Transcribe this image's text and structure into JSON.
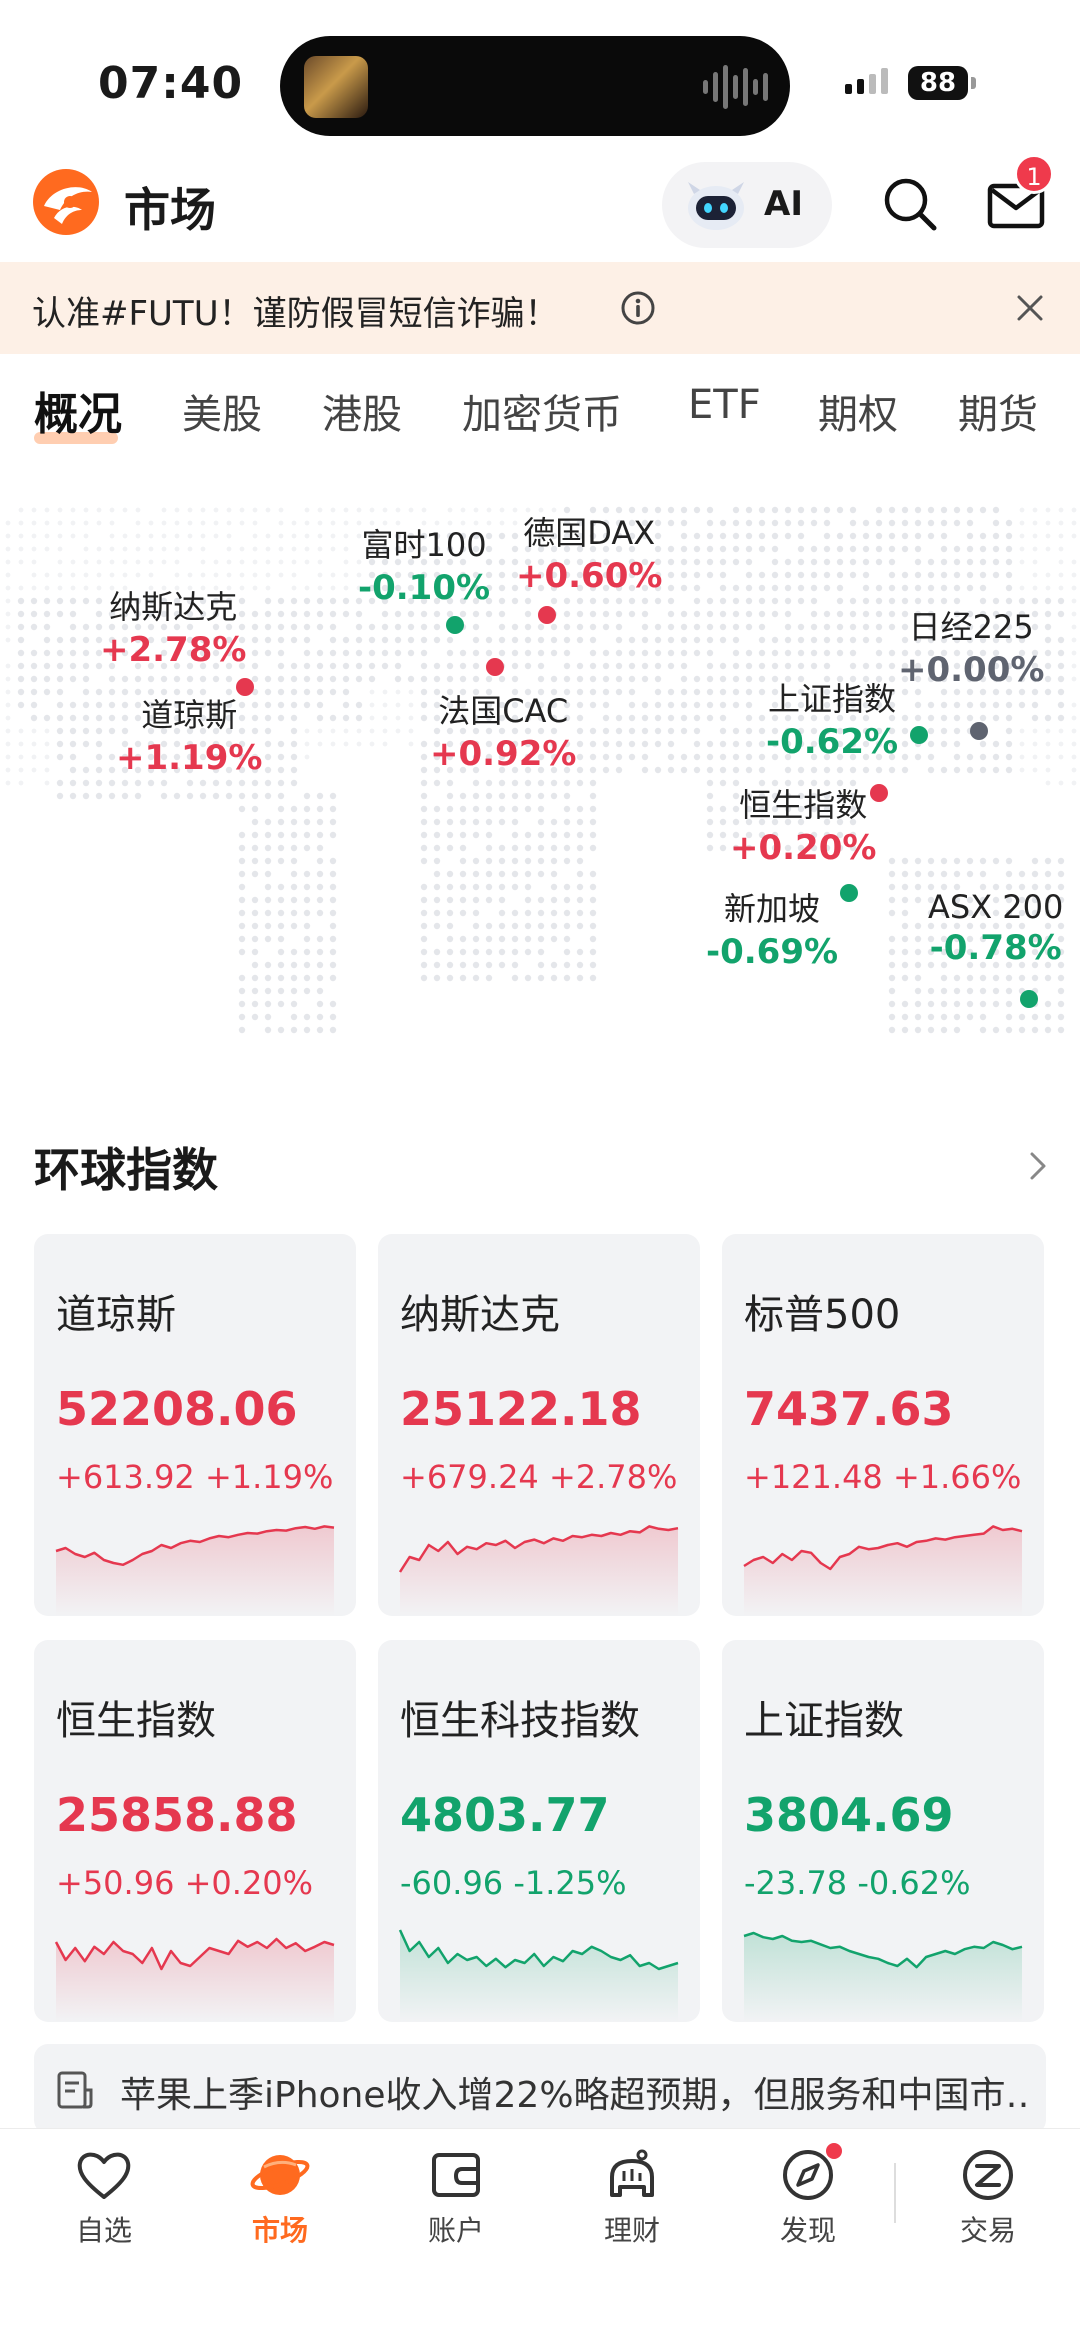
{
  "status": {
    "time": "07:40",
    "battery": "88"
  },
  "header": {
    "title": "市场",
    "ai_label": "AI",
    "mail_badge": "1"
  },
  "notice": {
    "text": "认准#FUTU！谨防假冒短信诈骗！"
  },
  "tabs": [
    {
      "label": "概况",
      "active": true
    },
    {
      "label": "美股"
    },
    {
      "label": "港股"
    },
    {
      "label": "加密货币"
    },
    {
      "label": "ETF"
    },
    {
      "label": "期权"
    },
    {
      "label": "期货"
    }
  ],
  "map_indices": [
    {
      "name": "纳斯达克",
      "change": "+2.78%",
      "trend": "up"
    },
    {
      "name": "道琼斯",
      "change": "+1.19%",
      "trend": "up"
    },
    {
      "name": "富时100",
      "change": "-0.10%",
      "trend": "down"
    },
    {
      "name": "德国DAX",
      "change": "+0.60%",
      "trend": "up"
    },
    {
      "name": "法国CAC",
      "change": "+0.92%",
      "trend": "up"
    },
    {
      "name": "日经225",
      "change": "+0.00%",
      "trend": "flat"
    },
    {
      "name": "上证指数",
      "change": "-0.62%",
      "trend": "down"
    },
    {
      "name": "恒生指数",
      "change": "+0.20%",
      "trend": "up"
    },
    {
      "name": "新加坡",
      "change": "-0.69%",
      "trend": "down"
    },
    {
      "name": "ASX 200",
      "change": "-0.78%",
      "trend": "down"
    }
  ],
  "global_indices": {
    "title": "环球指数",
    "cards": [
      {
        "name": "道琼斯",
        "value": "52208.06",
        "change": "+613.92 +1.19%",
        "trend": "up",
        "spark": [
          0.45,
          0.5,
          0.4,
          0.35,
          0.42,
          0.3,
          0.25,
          0.22,
          0.3,
          0.4,
          0.45,
          0.55,
          0.5,
          0.58,
          0.62,
          0.6,
          0.66,
          0.7,
          0.68,
          0.72,
          0.75,
          0.74,
          0.78,
          0.8,
          0.79,
          0.83,
          0.85,
          0.82,
          0.86,
          0.84
        ]
      },
      {
        "name": "纳斯达克",
        "value": "25122.18",
        "change": "+679.24 +2.78%",
        "trend": "up",
        "spark": [
          0.1,
          0.35,
          0.3,
          0.55,
          0.45,
          0.6,
          0.4,
          0.52,
          0.48,
          0.58,
          0.55,
          0.62,
          0.5,
          0.6,
          0.64,
          0.58,
          0.66,
          0.62,
          0.7,
          0.68,
          0.72,
          0.7,
          0.75,
          0.72,
          0.78,
          0.76,
          0.86,
          0.82,
          0.8,
          0.83
        ]
      },
      {
        "name": "标普500",
        "value": "7437.63",
        "change": "+121.48 +1.66%",
        "trend": "up",
        "spark": [
          0.2,
          0.3,
          0.35,
          0.25,
          0.4,
          0.3,
          0.45,
          0.42,
          0.25,
          0.15,
          0.35,
          0.4,
          0.52,
          0.48,
          0.5,
          0.55,
          0.58,
          0.52,
          0.6,
          0.62,
          0.66,
          0.64,
          0.68,
          0.7,
          0.72,
          0.74,
          0.86,
          0.8,
          0.82,
          0.78
        ]
      },
      {
        "name": "恒生指数",
        "value": "25858.88",
        "change": "+50.96 +0.20%",
        "trend": "up",
        "spark": [
          0.7,
          0.4,
          0.6,
          0.38,
          0.62,
          0.5,
          0.7,
          0.55,
          0.5,
          0.35,
          0.6,
          0.25,
          0.55,
          0.35,
          0.3,
          0.45,
          0.6,
          0.55,
          0.5,
          0.72,
          0.62,
          0.7,
          0.6,
          0.75,
          0.6,
          0.68,
          0.55,
          0.62,
          0.7,
          0.65
        ]
      },
      {
        "name": "恒生科技指数",
        "value": "4803.77",
        "change": "-60.96 -1.25%",
        "trend": "down",
        "spark": [
          0.9,
          0.55,
          0.7,
          0.45,
          0.6,
          0.35,
          0.5,
          0.4,
          0.45,
          0.3,
          0.42,
          0.28,
          0.4,
          0.35,
          0.5,
          0.3,
          0.45,
          0.38,
          0.55,
          0.5,
          0.62,
          0.55,
          0.45,
          0.4,
          0.48,
          0.3,
          0.35,
          0.25,
          0.3,
          0.35
        ]
      },
      {
        "name": "上证指数",
        "value": "3804.69",
        "change": "-23.78 -0.62%",
        "trend": "down",
        "spark": [
          0.8,
          0.85,
          0.78,
          0.75,
          0.8,
          0.72,
          0.7,
          0.72,
          0.66,
          0.6,
          0.62,
          0.55,
          0.5,
          0.45,
          0.42,
          0.35,
          0.3,
          0.42,
          0.28,
          0.45,
          0.5,
          0.55,
          0.5,
          0.58,
          0.62,
          0.6,
          0.7,
          0.65,
          0.58,
          0.62
        ]
      }
    ]
  },
  "news": {
    "text": "苹果上季iPhone收入增22%略超预期，但服务和中国市…"
  },
  "bottom_nav": [
    {
      "label": "自选"
    },
    {
      "label": "市场",
      "active": true
    },
    {
      "label": "账户"
    },
    {
      "label": "理财"
    },
    {
      "label": "发现"
    },
    {
      "label": "交易"
    }
  ],
  "colors": {
    "up": "#e5384f",
    "down": "#12a36c",
    "flat": "#5f6470",
    "accent": "#ff6a1f",
    "notice_bg": "#fdf0e6"
  }
}
